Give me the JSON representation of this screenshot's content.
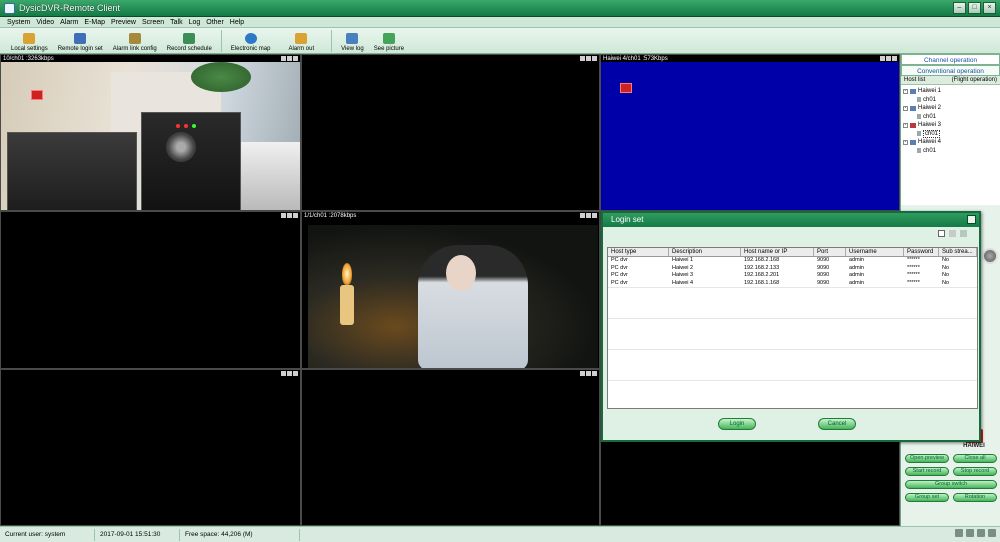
{
  "window": {
    "title": "DysicDVR-Remote Client"
  },
  "menu": [
    "System",
    "Video",
    "Alarm",
    "E-Map",
    "Preview",
    "Screen",
    "Talk",
    "Log",
    "Other",
    "Help"
  ],
  "toolbar": [
    {
      "label": "Local settings",
      "icon": "gear-icon",
      "color": "#d9a233"
    },
    {
      "label": "Remote login set",
      "icon": "user-globe-icon",
      "color": "#3f6fb8"
    },
    {
      "label": "Alarm link config",
      "icon": "alarm-link-icon",
      "color": "#a58a3a"
    },
    {
      "label": "Record schedule",
      "icon": "schedule-icon",
      "color": "#3b8f55"
    },
    {
      "label": "Electronic map",
      "icon": "globe-icon",
      "color": "#2e78c7"
    },
    {
      "label": "Alarm out",
      "icon": "alarm-out-icon",
      "color": "#d9a233"
    },
    {
      "label": "View log",
      "icon": "log-icon",
      "color": "#4a7fc0"
    },
    {
      "label": "See picture",
      "icon": "picture-icon",
      "color": "#46a35a"
    }
  ],
  "cells": {
    "c1": "10/ch01 :3263kbps",
    "c3": "Haiwei 4/ch01 :573Kbps",
    "c5": "1/1/ch01 :2078kbps"
  },
  "right_panel": {
    "tab_channel": "Channel operation",
    "tab_conventional": "Conventional operation",
    "host_list": "Host list",
    "flight_operation": "(Flight operation)",
    "hosts": [
      {
        "name": "Haiwei 1",
        "channel": "ch01"
      },
      {
        "name": "Haiwei 2",
        "channel": "ch01"
      },
      {
        "name": "Haiwei 3",
        "channel": "ch01"
      },
      {
        "name": "Haiwei 4",
        "channel": "ch01"
      }
    ],
    "brand": "HAIWEI",
    "buttons": {
      "open_preview": "Open preview",
      "close_all": "Close all",
      "start_record": "Start record",
      "stop_record": "Stop record",
      "group_switch": "Group switch",
      "group_set": "Group set",
      "rotation": "Rotation"
    }
  },
  "dialog": {
    "title": "Login set",
    "columns": [
      "Host type",
      "Description",
      "Host name or IP",
      "Port",
      "Username",
      "Password",
      "Sub strea..."
    ],
    "rows": [
      [
        "PC dvr",
        "Haiwei 1",
        "192.168.2.168",
        "9090",
        "admin",
        "******",
        "No"
      ],
      [
        "PC dvr",
        "Haiwei 2",
        "192.168.2.133",
        "9090",
        "admin",
        "******",
        "No"
      ],
      [
        "PC dvr",
        "Haiwei 3",
        "192.168.2.201",
        "9090",
        "admin",
        "******",
        "No"
      ],
      [
        "PC dvr",
        "Haiwei 4",
        "192.168.1.168",
        "9090",
        "admin",
        "******",
        "No"
      ]
    ],
    "login_label": "Login",
    "cancel_label": "Cancel"
  },
  "status": {
    "user": "Current user: system",
    "datetime": "2017-09-01 15:51:30",
    "free_space": "Free space: 44,206 (M)"
  }
}
